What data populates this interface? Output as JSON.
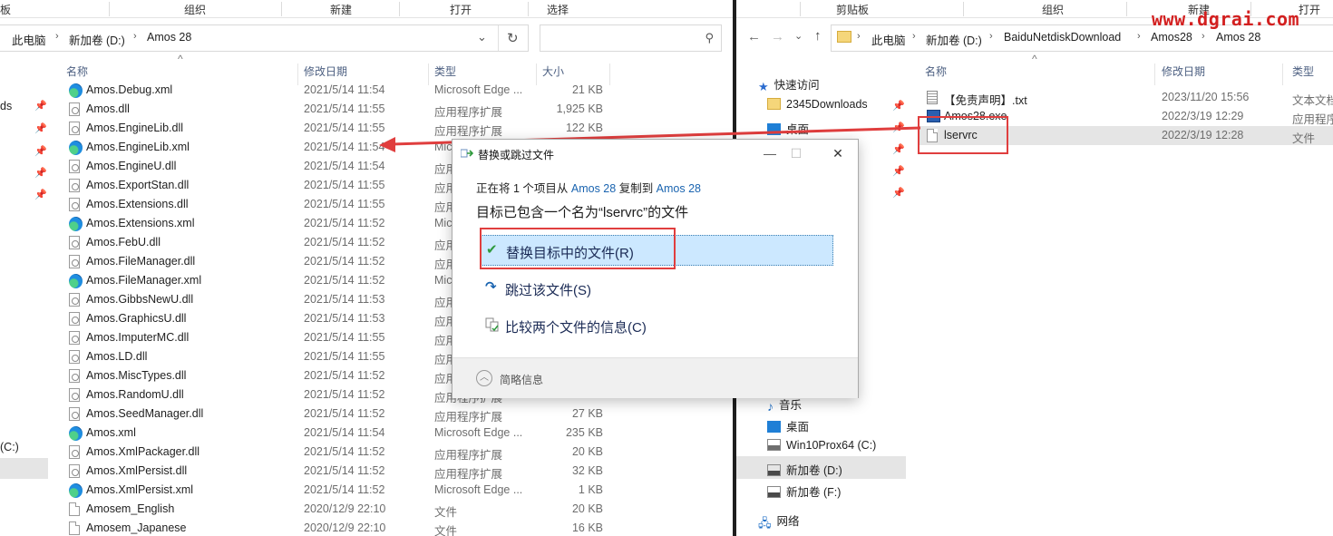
{
  "watermark": "www.dgrai.com",
  "colors": {
    "accent": "#1a64b0",
    "highlight": "#cce8ff",
    "annotation": "#e03e3e"
  },
  "left": {
    "ribbon": [
      "板",
      "组织",
      "新建",
      "打开",
      "选择"
    ],
    "address": {
      "crumbs": [
        "此电脑",
        "新加卷 (D:)",
        "Amos 28"
      ],
      "refresh_icon": "refresh-icon",
      "dropdown_icon": "chevron-down-icon"
    },
    "search_placeholder": "",
    "columns": {
      "name": "名称",
      "date": "修改日期",
      "type": "类型",
      "size": "大小"
    },
    "nav_fragments": [
      "ds",
      "(C:)"
    ],
    "files": [
      {
        "name": "Amos.Debug.xml",
        "date": "2021/5/14 11:54",
        "type": "Microsoft Edge ...",
        "size": "21 KB",
        "icon": "edge"
      },
      {
        "name": "Amos.dll",
        "date": "2021/5/14 11:55",
        "type": "应用程序扩展",
        "size": "1,925 KB",
        "icon": "dll"
      },
      {
        "name": "Amos.EngineLib.dll",
        "date": "2021/5/14 11:55",
        "type": "应用程序扩展",
        "size": "122 KB",
        "icon": "dll"
      },
      {
        "name": "Amos.EngineLib.xml",
        "date": "2021/5/14 11:54",
        "type": "Mic",
        "size": "",
        "icon": "edge"
      },
      {
        "name": "Amos.EngineU.dll",
        "date": "2021/5/14 11:54",
        "type": "应用",
        "size": "",
        "icon": "dll"
      },
      {
        "name": "Amos.ExportStan.dll",
        "date": "2021/5/14 11:55",
        "type": "应用",
        "size": "",
        "icon": "dll"
      },
      {
        "name": "Amos.Extensions.dll",
        "date": "2021/5/14 11:55",
        "type": "应用",
        "size": "",
        "icon": "dll"
      },
      {
        "name": "Amos.Extensions.xml",
        "date": "2021/5/14 11:52",
        "type": "Mic",
        "size": "",
        "icon": "edge"
      },
      {
        "name": "Amos.FebU.dll",
        "date": "2021/5/14 11:52",
        "type": "应用",
        "size": "",
        "icon": "dll"
      },
      {
        "name": "Amos.FileManager.dll",
        "date": "2021/5/14 11:52",
        "type": "应用",
        "size": "",
        "icon": "dll"
      },
      {
        "name": "Amos.FileManager.xml",
        "date": "2021/5/14 11:52",
        "type": "Mic",
        "size": "",
        "icon": "edge"
      },
      {
        "name": "Amos.GibbsNewU.dll",
        "date": "2021/5/14 11:53",
        "type": "应用",
        "size": "",
        "icon": "dll"
      },
      {
        "name": "Amos.GraphicsU.dll",
        "date": "2021/5/14 11:53",
        "type": "应用",
        "size": "",
        "icon": "dll"
      },
      {
        "name": "Amos.ImputerMC.dll",
        "date": "2021/5/14 11:55",
        "type": "应用",
        "size": "",
        "icon": "dll"
      },
      {
        "name": "Amos.LD.dll",
        "date": "2021/5/14 11:55",
        "type": "应用",
        "size": "",
        "icon": "dll"
      },
      {
        "name": "Amos.MiscTypes.dll",
        "date": "2021/5/14 11:52",
        "type": "应用",
        "size": "",
        "icon": "dll"
      },
      {
        "name": "Amos.RandomU.dll",
        "date": "2021/5/14 11:52",
        "type": "应用程序扩展",
        "size": "",
        "icon": "dll"
      },
      {
        "name": "Amos.SeedManager.dll",
        "date": "2021/5/14 11:52",
        "type": "应用程序扩展",
        "size": "27 KB",
        "icon": "dll"
      },
      {
        "name": "Amos.xml",
        "date": "2021/5/14 11:54",
        "type": "Microsoft Edge ...",
        "size": "235 KB",
        "icon": "edge"
      },
      {
        "name": "Amos.XmlPackager.dll",
        "date": "2021/5/14 11:52",
        "type": "应用程序扩展",
        "size": "20 KB",
        "icon": "dll"
      },
      {
        "name": "Amos.XmlPersist.dll",
        "date": "2021/5/14 11:52",
        "type": "应用程序扩展",
        "size": "32 KB",
        "icon": "dll"
      },
      {
        "name": "Amos.XmlPersist.xml",
        "date": "2021/5/14 11:52",
        "type": "Microsoft Edge ...",
        "size": "1 KB",
        "icon": "edge"
      },
      {
        "name": "Amosem_English",
        "date": "2020/12/9 22:10",
        "type": "文件",
        "size": "20 KB",
        "icon": "file"
      },
      {
        "name": "Amosem_Japanese",
        "date": "2020/12/9 22:10",
        "type": "文件",
        "size": "16 KB",
        "icon": "file"
      }
    ]
  },
  "right": {
    "ribbon": [
      "剪贴板",
      "组织",
      "新建",
      "打开"
    ],
    "address": {
      "crumbs": [
        "此电脑",
        "新加卷 (D:)",
        "BaiduNetdiskDownload",
        "Amos28",
        "Amos 28"
      ]
    },
    "columns": {
      "name": "名称",
      "date": "修改日期",
      "type": "类型"
    },
    "nav": [
      {
        "label": "快速访问",
        "icon": "star-icon"
      },
      {
        "label": "2345Downloads",
        "icon": "folder-icon"
      },
      {
        "label": "桌面",
        "icon": "desktop-icon"
      },
      {
        "label": "音乐",
        "icon": "music-icon"
      },
      {
        "label": "桌面",
        "icon": "desktop-icon"
      },
      {
        "label": "Win10Prox64 (C:)",
        "icon": "drive-icon"
      },
      {
        "label": "新加卷 (D:)",
        "icon": "drive-icon"
      },
      {
        "label": "新加卷 (F:)",
        "icon": "drive-icon"
      },
      {
        "label": "网络",
        "icon": "network-icon"
      }
    ],
    "files": [
      {
        "name": "【免责声明】.txt",
        "date": "2023/11/20 15:56",
        "type": "文本文档",
        "icon": "txt"
      },
      {
        "name": "Amos28.exe",
        "date": "2022/3/19 12:29",
        "type": "应用程序",
        "icon": "exe"
      },
      {
        "name": "lservrc",
        "date": "2022/3/19 12:28",
        "type": "文件",
        "icon": "file"
      }
    ]
  },
  "dialog": {
    "title": "替换或跳过文件",
    "line_prefix": "正在将 1 个项目从 ",
    "line_source": "Amos 28",
    "line_middle": " 复制到 ",
    "line_dest": "Amos 28",
    "heading": "目标已包含一个名为“lservrc”的文件",
    "options": {
      "replace": "替换目标中的文件(R)",
      "skip": "跳过该文件(S)",
      "compare": "比较两个文件的信息(C)"
    },
    "footer": "简略信息"
  }
}
